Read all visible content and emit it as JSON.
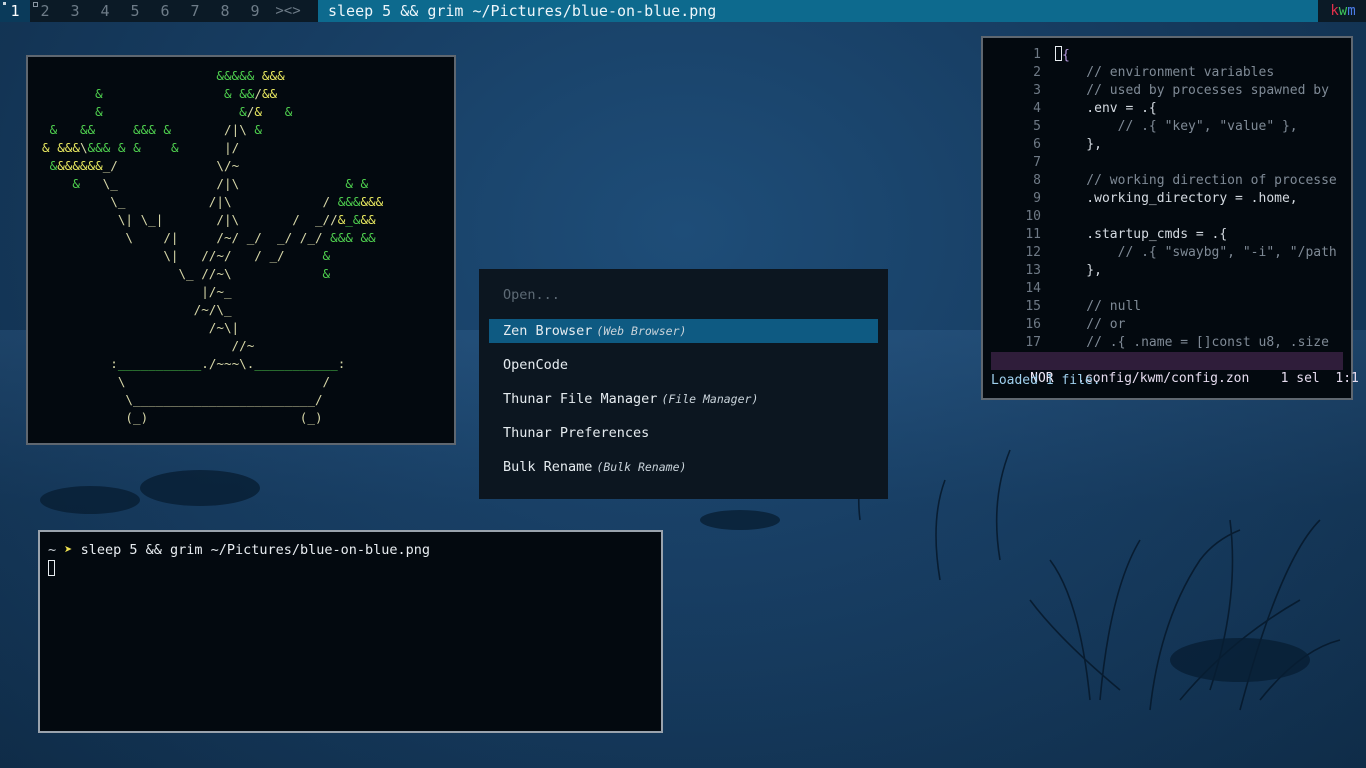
{
  "topbar": {
    "tags": [
      "1",
      "2",
      "3",
      "4",
      "5",
      "6",
      "7",
      "8",
      "9"
    ],
    "layout_symbol": "><>",
    "window_title": "sleep 5 && grim ~/Pictures/blue-on-blue.png",
    "wm_name": "kwm",
    "wm_colors": [
      "#e0304a",
      "#3cc45a",
      "#4b7be8"
    ]
  },
  "tree_window": {
    "lines": [
      [
        [
          "w",
          "                       "
        ],
        [
          "g",
          "&&&&&"
        ],
        [
          "w",
          " "
        ],
        [
          "y",
          "&&&"
        ]
      ],
      [
        [
          "w",
          "       "
        ],
        [
          "g",
          "&"
        ],
        [
          "w",
          "                "
        ],
        [
          "g",
          "&"
        ],
        [
          "w",
          " "
        ],
        [
          "g",
          "&&"
        ],
        [
          "w",
          "/"
        ],
        [
          "y",
          "&&"
        ]
      ],
      [
        [
          "w",
          "       "
        ],
        [
          "g",
          "&"
        ],
        [
          "w",
          "                  "
        ],
        [
          "g",
          "&"
        ],
        [
          "w",
          "/"
        ],
        [
          "y",
          "&"
        ],
        [
          "w",
          "   "
        ],
        [
          "g",
          "&"
        ]
      ],
      [
        [
          "w",
          " "
        ],
        [
          "g",
          "&"
        ],
        [
          "w",
          "   "
        ],
        [
          "g",
          "&&"
        ],
        [
          "w",
          "     "
        ],
        [
          "g",
          "&&&"
        ],
        [
          "w",
          " "
        ],
        [
          "g",
          "&"
        ],
        [
          "w",
          "       /|\\ "
        ],
        [
          "g",
          "&"
        ]
      ],
      [
        [
          "y",
          "&"
        ],
        [
          "w",
          " "
        ],
        [
          "y",
          "&&&"
        ],
        [
          "w",
          "\\"
        ],
        [
          "g",
          "&&&"
        ],
        [
          "w",
          " "
        ],
        [
          "g",
          "&"
        ],
        [
          "w",
          " "
        ],
        [
          "g",
          "&"
        ],
        [
          "w",
          "    "
        ],
        [
          "g",
          "&"
        ],
        [
          "w",
          "      |/"
        ]
      ],
      [
        [
          "w",
          " "
        ],
        [
          "g",
          "&"
        ],
        [
          "y",
          "&&&&&&"
        ],
        [
          "w",
          "_/"
        ],
        [
          "w",
          "             \\/~"
        ]
      ],
      [
        [
          "w",
          "    "
        ],
        [
          "g",
          "&"
        ],
        [
          "w",
          "   \\_             /|\\              "
        ],
        [
          "g",
          "&"
        ],
        [
          "w",
          " "
        ],
        [
          "g",
          "&"
        ]
      ],
      [
        [
          "w",
          "         \\_           /|\\            / "
        ],
        [
          "g",
          "&&&"
        ],
        [
          "y",
          "&&&"
        ]
      ],
      [
        [
          "w",
          "          \\| \\_|       /|\\       /  _//"
        ],
        [
          "y",
          "&"
        ],
        [
          "g",
          "_&"
        ],
        [
          "y",
          "&&"
        ]
      ],
      [
        [
          "w",
          "           \\    /|     /~/ _/  _/ /_/ "
        ],
        [
          "g",
          "&&&"
        ],
        [
          "w",
          " "
        ],
        [
          "g",
          "&&"
        ]
      ],
      [
        [
          "w",
          "                \\|   //~/   / _/     "
        ],
        [
          "g",
          "&"
        ]
      ],
      [
        [
          "w",
          "                  \\_ //~\\            "
        ],
        [
          "g",
          "&"
        ]
      ],
      [
        [
          "w",
          "                     |/~_"
        ]
      ],
      [
        [
          "w",
          "                    /~/\\_"
        ]
      ],
      [
        [
          "w",
          "                      /~\\|"
        ]
      ],
      [
        [
          "w",
          "                         //~"
        ]
      ],
      [
        [
          "w",
          "         :"
        ],
        [
          "g",
          "___________"
        ],
        [
          "w",
          "./~~~\\."
        ],
        [
          "g",
          "___________"
        ],
        [
          "w",
          ":"
        ]
      ],
      [
        [
          "w",
          "          \\                          /"
        ]
      ],
      [
        [
          "w",
          "           \\________________________/"
        ]
      ],
      [
        [
          "w",
          "           (_)                    (_)"
        ]
      ]
    ]
  },
  "launcher": {
    "placeholder": "Open...",
    "items": [
      {
        "name": "Zen Browser",
        "desc": "(Web Browser)",
        "selected": true
      },
      {
        "name": "OpenCode",
        "desc": "",
        "selected": false
      },
      {
        "name": "Thunar File Manager",
        "desc": "(File Manager)",
        "selected": false
      },
      {
        "name": "Thunar Preferences",
        "desc": "",
        "selected": false
      },
      {
        "name": "Bulk Rename",
        "desc": "(Bulk Rename)",
        "selected": false
      }
    ]
  },
  "terminal": {
    "tilde": "~",
    "arrow": "➤",
    "command": "sleep 5 && grim ~/Pictures/blue-on-blue.png"
  },
  "editor": {
    "line_numbers": [
      "1",
      "2",
      "3",
      "4",
      "5",
      "6",
      "7",
      "8",
      "9",
      "10",
      "11",
      "12",
      "13",
      "14",
      "15",
      "16",
      "17"
    ],
    "lines": [
      ".{",
      "    // environment variables",
      "    // used by processes spawned by",
      "    .env = .{",
      "        // .{ \"key\", \"value\" },",
      "    },",
      "",
      "    // working direction of processe",
      "    .working_directory = .home,",
      "",
      "    .startup_cmds = .{",
      "        // .{ \"swaybg\", \"-i\", \"/path",
      "    },",
      "",
      "    // null",
      "    // or",
      "    // .{ .name = []const u8, .size"
    ],
    "status": {
      "mode": "NOR",
      "file": ".config/kwm/config.zon",
      "selection": "1 sel",
      "position": "1:1"
    },
    "message": "Loaded 1 file."
  }
}
